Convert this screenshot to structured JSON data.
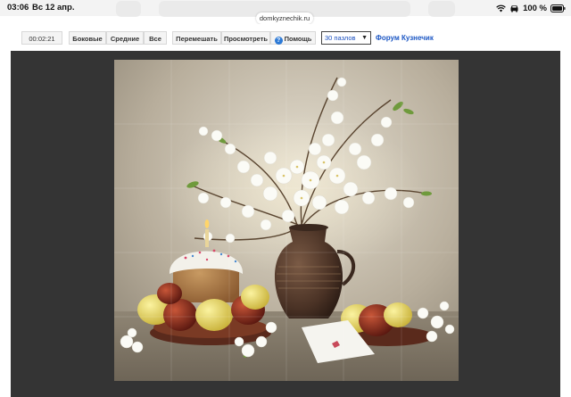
{
  "status_bar": {
    "time": "03:06",
    "date": "Вс 12 апр.",
    "url": "domkyznechik.ru",
    "battery_text": "100 %",
    "icons": [
      "wifi-icon",
      "car-icon",
      "battery-icon"
    ]
  },
  "toolbar": {
    "timer": "00:02:21",
    "buttons": {
      "side": "Боковые",
      "middle": "Средние",
      "all": "Все",
      "shuffle": "Перемешать",
      "preview": "Просмотреть",
      "help": "Помощь"
    },
    "pieces_select": {
      "selected": "30 пазлов"
    },
    "forum_link": "Форум Кузнечик"
  },
  "colors": {
    "stage_background": "#343434",
    "link": "#1c57c4",
    "select_text": "#1a4fbf"
  },
  "puzzle": {
    "subject": "still life: white blossom branches in a clay jug, Easter cake with candle, colored eggs"
  }
}
